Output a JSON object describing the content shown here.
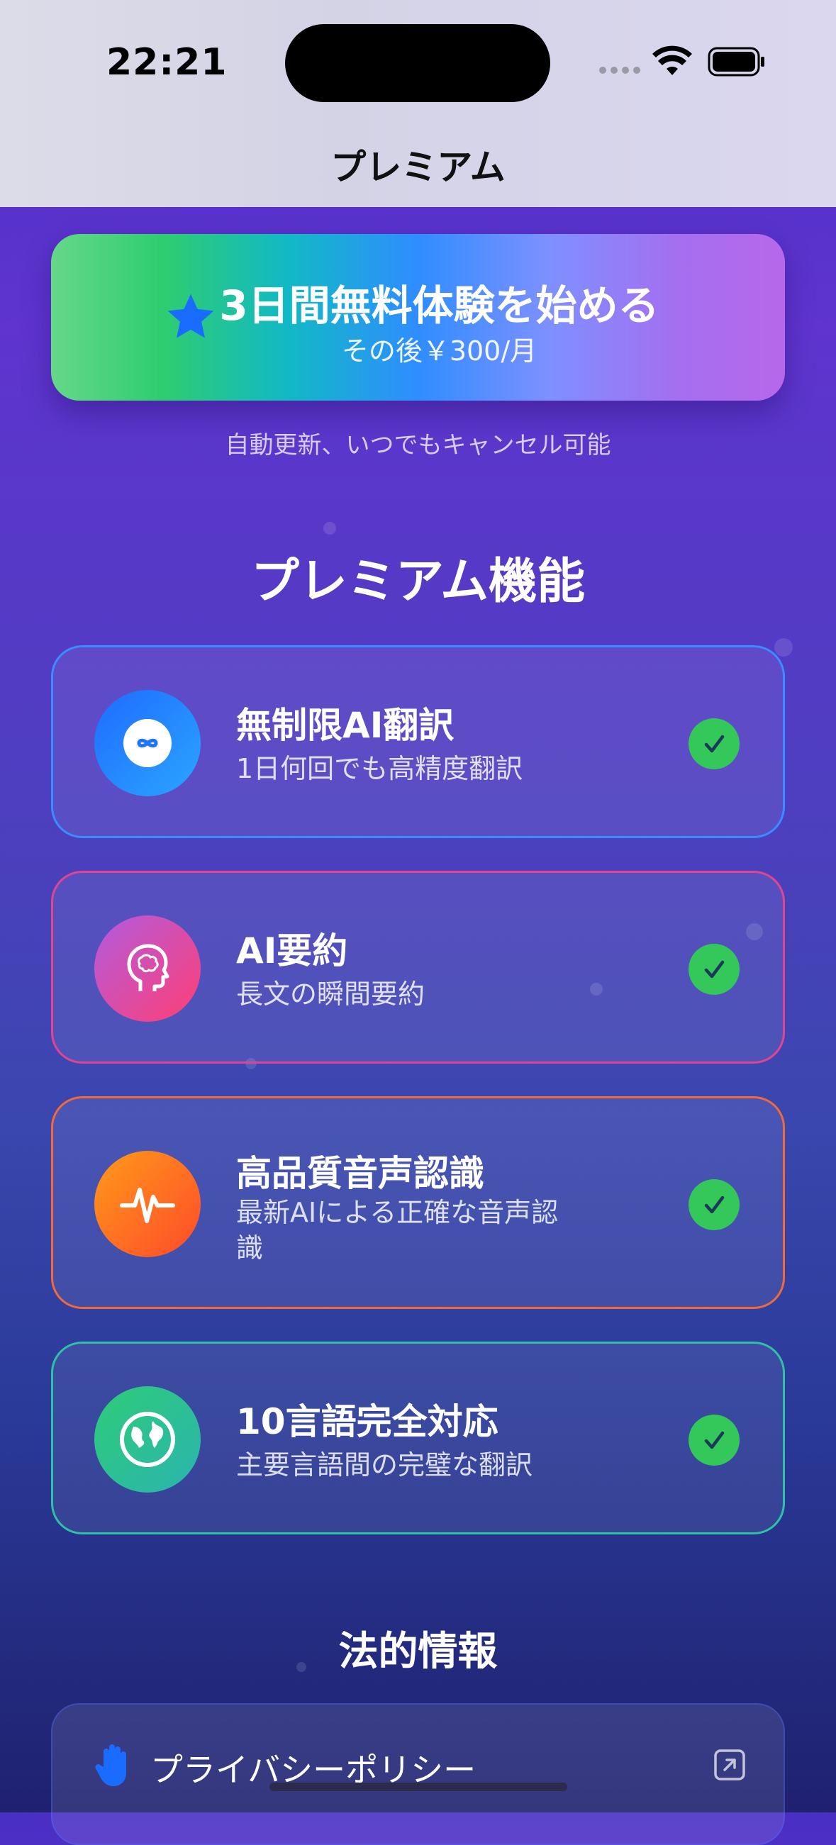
{
  "status_bar": {
    "time": "22:21"
  },
  "nav": {
    "title": "プレミアム"
  },
  "cta": {
    "title": "3日間無料体験を始める",
    "subtitle": "その後￥300/月",
    "note": "自動更新、いつでもキャンセル可能",
    "icon": "star-icon"
  },
  "features": {
    "title": "プレミアム機能",
    "items": [
      {
        "title": "無制限AI翻訳",
        "desc": "1日何回でも高精度翻訳",
        "icon": "infinity-icon",
        "border": "#3a8cff"
      },
      {
        "title": "AI要約",
        "desc": "長文の瞬間要約",
        "icon": "brain-head-icon",
        "border": "#e0468f"
      },
      {
        "title": "高品質音声認識",
        "desc": "最新AIによる正確な音声認識",
        "icon": "waveform-icon",
        "border": "#f06a3a"
      },
      {
        "title": "10言語完全対応",
        "desc": "主要言語間の完璧な翻訳",
        "icon": "globe-icon",
        "border": "#2fc0a8"
      }
    ]
  },
  "legal": {
    "title": "法的情報",
    "items": [
      {
        "label": "プライバシーポリシー",
        "icon": "hand-raised-icon"
      }
    ]
  },
  "colors": {
    "accent_green": "#34c759",
    "accent_blue": "#2f8dff"
  }
}
